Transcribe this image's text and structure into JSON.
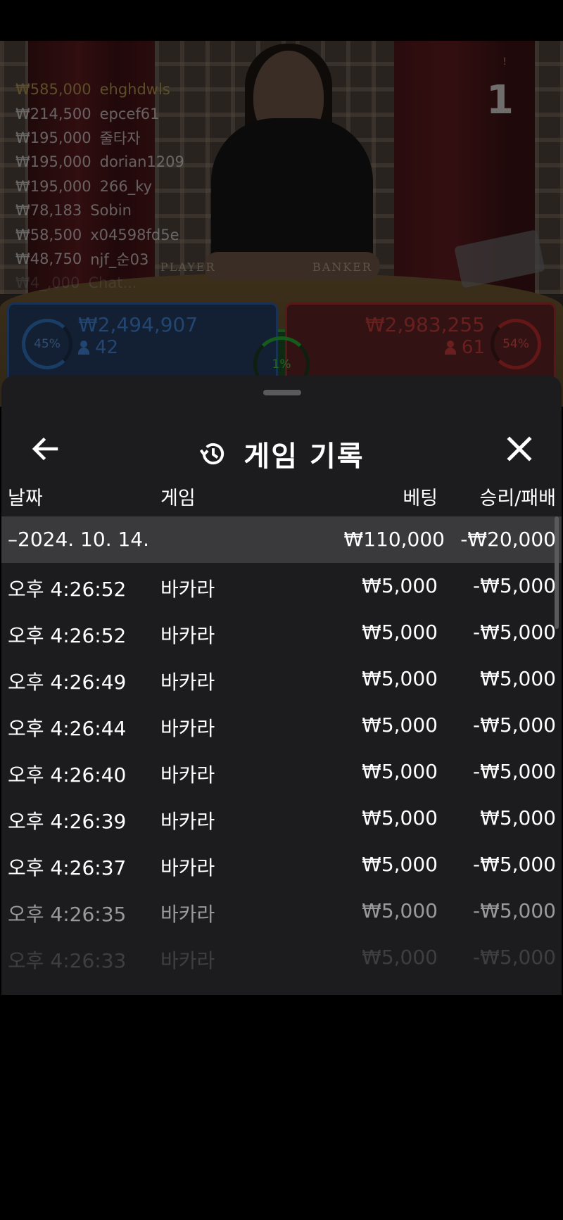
{
  "stream": {
    "round_number": "1",
    "round_mark": "!",
    "table_labels": {
      "player": "PLAYER",
      "banker": "BANKER"
    },
    "bets": [
      {
        "amount": "₩585,000",
        "user": "ehghdwls"
      },
      {
        "amount": "₩214,500",
        "user": "epcef61"
      },
      {
        "amount": "₩195,000",
        "user": "줄타자"
      },
      {
        "amount": "₩195,000",
        "user": "dorian1209"
      },
      {
        "amount": "₩195,000",
        "user": "266_ky"
      },
      {
        "amount": "₩78,183",
        "user": "Sobin"
      },
      {
        "amount": "₩58,500",
        "user": "x04598fd5e"
      },
      {
        "amount": "₩48,750",
        "user": "njf_순03"
      },
      {
        "amount": "₩4_,000",
        "user": "Chat..."
      }
    ],
    "player": {
      "percent": "45%",
      "amount": "₩2,494,907",
      "count": "42"
    },
    "banker": {
      "percent": "54%",
      "amount": "₩2,983,255",
      "count": "61"
    },
    "tie": {
      "percent": "1%"
    }
  },
  "sheet": {
    "title": "게임 기록",
    "columns": {
      "date": "날짜",
      "game": "게임",
      "bet": "베팅",
      "result": "승리/패배"
    },
    "summary": {
      "date": "–2024. 10. 14.",
      "bet": "₩110,000",
      "result": "-₩20,000"
    },
    "rows": [
      {
        "time": "오후 4:26:52",
        "game": "바카라",
        "bet": "₩5,000",
        "result": "-₩5,000"
      },
      {
        "time": "오후 4:26:52",
        "game": "바카라",
        "bet": "₩5,000",
        "result": "-₩5,000"
      },
      {
        "time": "오후 4:26:49",
        "game": "바카라",
        "bet": "₩5,000",
        "result": "₩5,000"
      },
      {
        "time": "오후 4:26:44",
        "game": "바카라",
        "bet": "₩5,000",
        "result": "-₩5,000"
      },
      {
        "time": "오후 4:26:40",
        "game": "바카라",
        "bet": "₩5,000",
        "result": "-₩5,000"
      },
      {
        "time": "오후 4:26:39",
        "game": "바카라",
        "bet": "₩5,000",
        "result": "₩5,000"
      },
      {
        "time": "오후 4:26:37",
        "game": "바카라",
        "bet": "₩5,000",
        "result": "-₩5,000"
      },
      {
        "time": "오후 4:26:35",
        "game": "바카라",
        "bet": "₩5,000",
        "result": "-₩5,000"
      },
      {
        "time": "오후 4:26:33",
        "game": "바카라",
        "bet": "₩5,000",
        "result": "-₩5,000"
      }
    ]
  },
  "colors": {
    "sheet_bg": "#1c1c1e",
    "summary_bg": "#3a3a3c",
    "player_blue": "#3f7fcf",
    "banker_red": "#c23a3a",
    "tie_green": "#3bc244"
  },
  "icons": {
    "back": "arrow-left-icon",
    "close": "close-icon",
    "history": "history-icon"
  }
}
